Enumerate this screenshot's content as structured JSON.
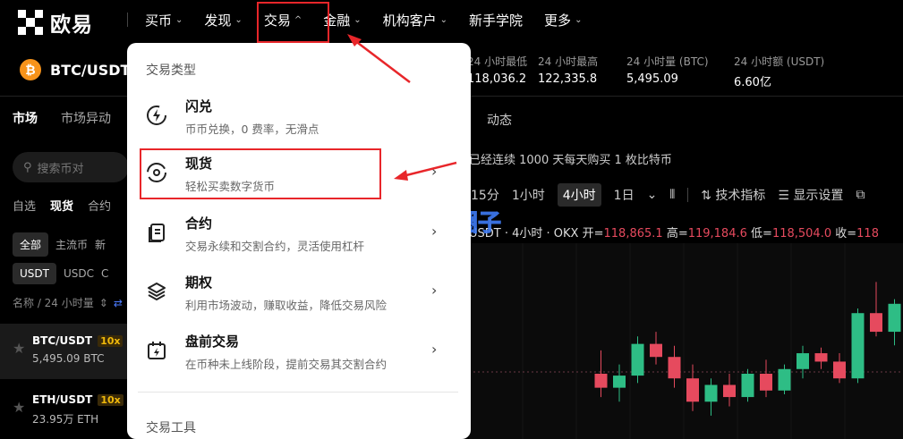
{
  "brand": {
    "name": "欧易"
  },
  "nav": [
    {
      "label": "买币",
      "caret": "⌄"
    },
    {
      "label": "发现",
      "caret": "⌄"
    },
    {
      "label": "交易",
      "caret": "^"
    },
    {
      "label": "金融",
      "caret": "⌄"
    },
    {
      "label": "机构客户",
      "caret": "⌄"
    },
    {
      "label": "新手学院",
      "caret": ""
    },
    {
      "label": "更多",
      "caret": "⌄"
    }
  ],
  "ticker": {
    "pair": "BTC/USDT",
    "stats": [
      {
        "label": "24 小时最低",
        "value": "118,036.2"
      },
      {
        "label": "24 小时最高",
        "value": "122,335.8"
      },
      {
        "label": "24 小时量 (BTC)",
        "value": "5,495.09"
      },
      {
        "label": "24 小时额 (USDT)",
        "value": "6.60亿"
      }
    ]
  },
  "sidebar": {
    "tabs": [
      "市场",
      "市场异动"
    ],
    "search_placeholder": "搜索币对",
    "tabs2": [
      "自选",
      "现货",
      "合约"
    ],
    "chips": [
      "全部",
      "主流币",
      "新"
    ],
    "chips2": [
      "USDT",
      "USDC",
      "C"
    ],
    "sort_label": "名称 / 24 小时量",
    "sort_caret": "⇕",
    "sort_swap": "⇄",
    "rows": [
      {
        "symbol": "BTC/USDT",
        "leverage": "10x",
        "volume": "5,495.09 BTC"
      },
      {
        "symbol": "ETH/USDT",
        "leverage": "10x",
        "volume": "23.95万 ETH"
      }
    ]
  },
  "right": {
    "subtab": "动态",
    "notice": "已经连续 1000 天每天购买 1 枚比特币",
    "timeframes": [
      "15分",
      "1小时",
      "4小时",
      "1日"
    ],
    "tf_more": "⌄",
    "tools": [
      "技术指标",
      "显示设置"
    ],
    "info": {
      "prefix": "USDT · 4小时 · OKX",
      "open_label": "开=",
      "open": "118,865.1",
      "high_label": "高=",
      "high": "119,184.6",
      "low_label": "低=",
      "low": "118,504.0",
      "close_label": "收=",
      "close": "118"
    }
  },
  "watermark": {
    "text": "币圈子"
  },
  "dropdown": {
    "section1": "交易类型",
    "items": [
      {
        "title": "闪兑",
        "desc": "币币兑换，0 费率，无滑点",
        "chevron": false
      },
      {
        "title": "现货",
        "desc": "轻松买卖数字货币",
        "chevron": true
      },
      {
        "title": "合约",
        "desc": "交易永续和交割合约，灵活使用杠杆",
        "chevron": true
      },
      {
        "title": "期权",
        "desc": "利用市场波动，赚取收益，降低交易风险",
        "chevron": true
      },
      {
        "title": "盘前交易",
        "desc": "在币种未上线阶段，提前交易其交割合约",
        "chevron": true
      }
    ],
    "chevron": "›",
    "section2": "交易工具"
  },
  "colors": {
    "accent_red": "#e8262a",
    "up": "#2ebd85",
    "down": "#e64a5e",
    "btc": "#f7931a",
    "watermark_blue": "#3f7cf5"
  },
  "chart_data": {
    "type": "candlestick",
    "interval": "4小时",
    "candles": [
      {
        "o": 118200,
        "h": 118450,
        "l": 117950,
        "c": 118050
      },
      {
        "o": 118050,
        "h": 118300,
        "l": 117900,
        "c": 118180
      },
      {
        "o": 118180,
        "h": 118600,
        "l": 118100,
        "c": 118520
      },
      {
        "o": 118520,
        "h": 118650,
        "l": 118300,
        "c": 118380
      },
      {
        "o": 118380,
        "h": 118500,
        "l": 118050,
        "c": 118150
      },
      {
        "o": 118150,
        "h": 118300,
        "l": 117800,
        "c": 117900
      },
      {
        "o": 117900,
        "h": 118150,
        "l": 117750,
        "c": 118080
      },
      {
        "o": 118080,
        "h": 118200,
        "l": 117850,
        "c": 117950
      },
      {
        "o": 117950,
        "h": 118250,
        "l": 117900,
        "c": 118200
      },
      {
        "o": 118200,
        "h": 118350,
        "l": 117950,
        "c": 118020
      },
      {
        "o": 118020,
        "h": 118300,
        "l": 117980,
        "c": 118250
      },
      {
        "o": 118250,
        "h": 118500,
        "l": 118150,
        "c": 118420
      },
      {
        "o": 118420,
        "h": 118480,
        "l": 118250,
        "c": 118330
      },
      {
        "o": 118330,
        "h": 118420,
        "l": 118100,
        "c": 118150
      },
      {
        "o": 118150,
        "h": 118900,
        "l": 118100,
        "c": 118850
      },
      {
        "o": 118850,
        "h": 119184.6,
        "l": 118600,
        "c": 118650
      },
      {
        "o": 118650,
        "h": 119000,
        "l": 118504,
        "c": 118950
      }
    ],
    "ylim": [
      117500,
      119600
    ]
  }
}
